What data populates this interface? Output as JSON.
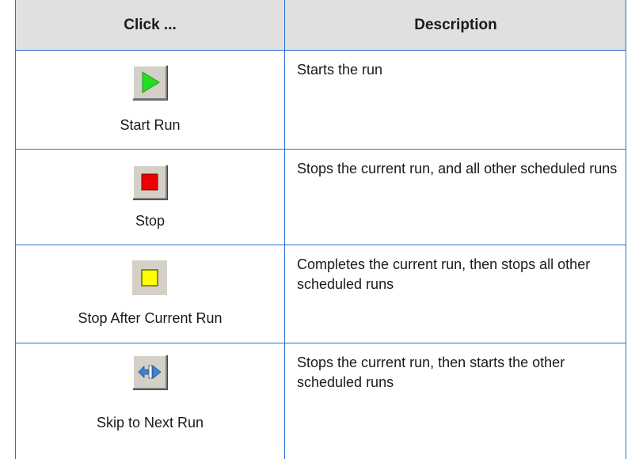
{
  "table": {
    "headers": {
      "click": "Click ...",
      "description": "Description"
    },
    "rows": [
      {
        "label": "Start Run",
        "icon": "play-icon",
        "description": "Starts the run"
      },
      {
        "label": "Stop",
        "icon": "stop-icon",
        "description": "Stops the current run, and all other scheduled runs"
      },
      {
        "label": "Stop After Current Run",
        "icon": "stop-after-current-icon",
        "description": "Completes the current run, then stops all other scheduled runs"
      },
      {
        "label": "Skip to Next Run",
        "icon": "skip-next-icon",
        "description": "Stops the current run, then starts the other scheduled runs"
      }
    ]
  },
  "colors": {
    "border": "#2a6fd0",
    "header_bg": "#e0e0e0",
    "play": "#22dd22",
    "stop": "#ee0000",
    "stop_after": "#ffff00",
    "skip": "#3a86d6"
  }
}
